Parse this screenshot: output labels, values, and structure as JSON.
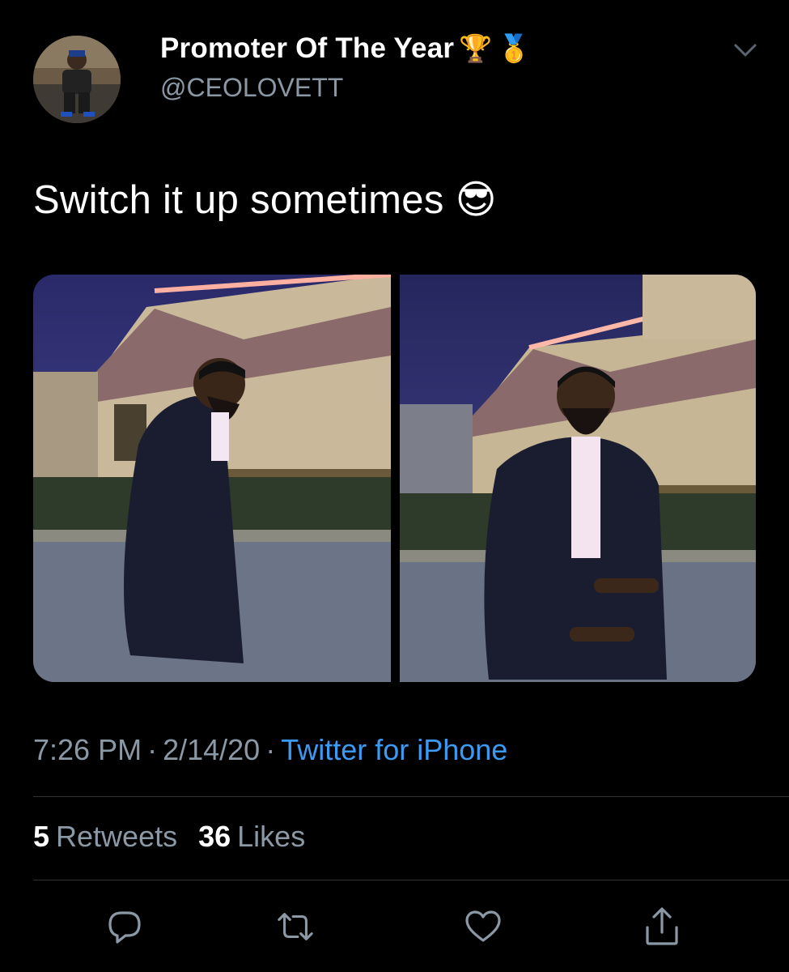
{
  "tweet": {
    "display_name": "Promoter Of The Year",
    "name_emojis": [
      "🏆",
      "🥇"
    ],
    "handle": "@CEOLOVETT",
    "text": "Switch it up sometimes",
    "text_emoji": "😎",
    "time": "7:26 PM",
    "date": "2/14/20",
    "separator": "·",
    "source": "Twitter for iPhone",
    "retweets_count": "5",
    "retweets_label": "Retweets",
    "likes_count": "36",
    "likes_label": "Likes"
  },
  "icons": {
    "menu": "chevron-down-icon",
    "reply": "reply-icon",
    "retweet": "retweet-icon",
    "like": "heart-icon",
    "share": "share-icon"
  },
  "colors": {
    "background": "#000000",
    "text": "#ffffff",
    "secondary": "#8b98a5",
    "link": "#3d9af2",
    "divider": "#2f3336"
  }
}
